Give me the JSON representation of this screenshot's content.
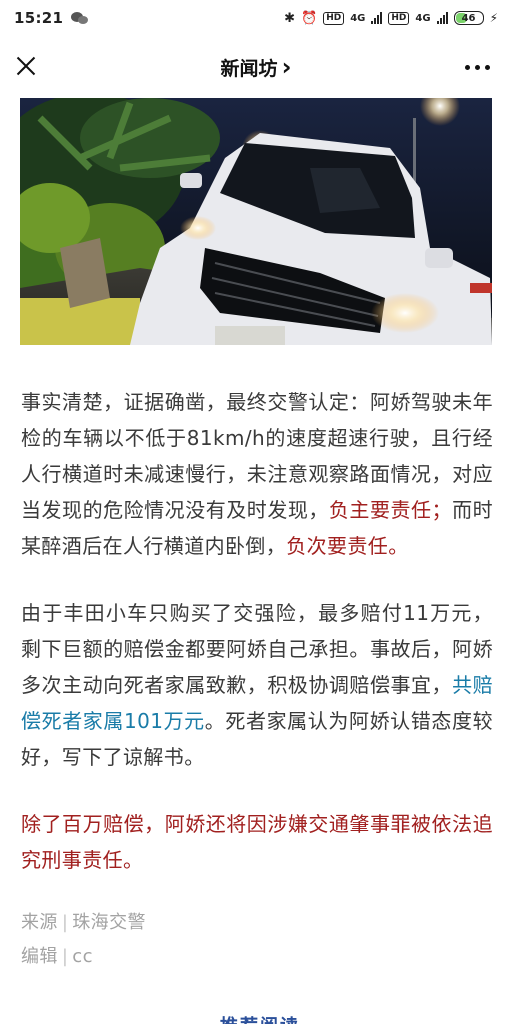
{
  "status_bar": {
    "time": "15:21",
    "network_1": "4G",
    "network_2": "4G",
    "hd_1": "HD",
    "hd_2": "HD",
    "battery": "46"
  },
  "nav": {
    "title": "新闻坊",
    "chevron": "›"
  },
  "article": {
    "para1": [
      {
        "text": "事实清楚，证据确凿，最终交警认定：阿娇驾驶未年检的车辆以不低于81km/h的速度超速行驶，且行经人行横道时未减速慢行，未注意观察路面情况，对应当发现的危险情况没有及时发现，",
        "style": "normal"
      },
      {
        "text": "负主要责任；",
        "style": "red"
      },
      {
        "text": "而时某醉酒后在人行横道内卧倒，",
        "style": "normal"
      },
      {
        "text": "负次要责任。",
        "style": "red"
      }
    ],
    "para2": [
      {
        "text": "由于丰田小车只购买了交强险，最多赔付11万元，剩下巨额的赔偿金都要阿娇自己承担。事故后，阿娇多次主动向死者家属致歉，积极协调赔偿事宜，",
        "style": "normal"
      },
      {
        "text": "共赔偿死者家属101万元",
        "style": "blue"
      },
      {
        "text": "。死者家属认为阿娇认错态度较好，写下了谅解书。",
        "style": "normal"
      }
    ],
    "para3": "除了百万赔偿，阿娇还将因涉嫌交通肇事罪被依法追究刑事责任。",
    "source_label": "来源",
    "source_value": "珠海交警",
    "editor_label": "编辑",
    "editor_value": "cc",
    "separator": "|"
  },
  "teaser": "推荐阅读",
  "colors": {
    "red_text": "#a1201f",
    "blue_text": "#1a7ca8",
    "meta_text": "#a3a3a3"
  }
}
